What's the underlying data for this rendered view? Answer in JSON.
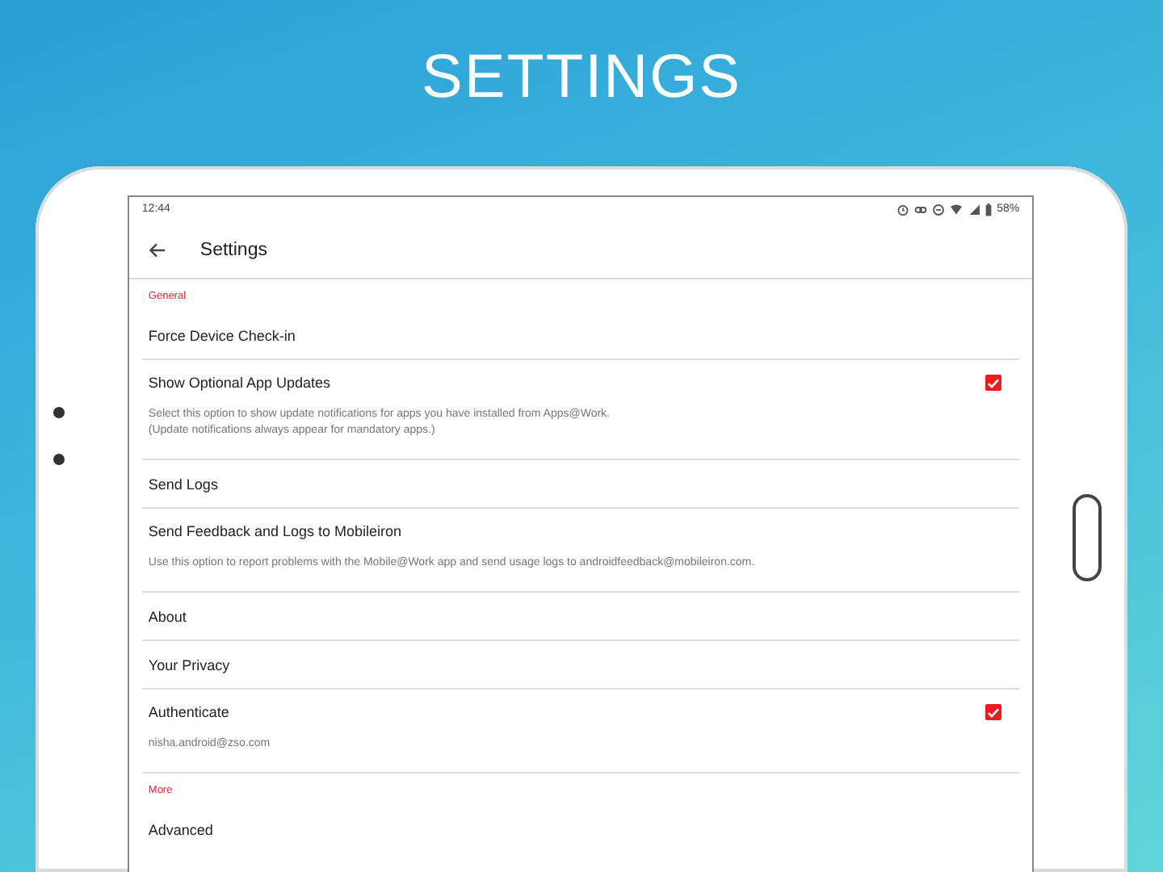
{
  "headline": "SETTINGS",
  "status_bar": {
    "time": "12:44",
    "battery": "58%"
  },
  "toolbar": {
    "title": "Settings"
  },
  "sections": [
    {
      "header": "General",
      "items": [
        {
          "kind": "plain",
          "title": "Force Device Check-in"
        },
        {
          "kind": "checkbox",
          "title": "Show Optional App Updates",
          "checked": true,
          "description": "Select this option to show update notifications for apps you have installed from Apps@Work.\n(Update notifications always appear for mandatory apps.)"
        },
        {
          "kind": "plain",
          "title": "Send Logs"
        },
        {
          "kind": "plain",
          "title": "Send Feedback and Logs to Mobileiron",
          "description": "Use this option to report problems with the Mobile@Work app and send usage logs to androidfeedback@mobileiron.com."
        },
        {
          "kind": "plain",
          "title": "About"
        },
        {
          "kind": "plain",
          "title": "Your Privacy"
        },
        {
          "kind": "checkbox",
          "title": "Authenticate",
          "checked": true,
          "description": "nisha.android@zso.com"
        }
      ]
    },
    {
      "header": "More",
      "items": [
        {
          "kind": "plain",
          "title": "Advanced"
        }
      ]
    }
  ]
}
